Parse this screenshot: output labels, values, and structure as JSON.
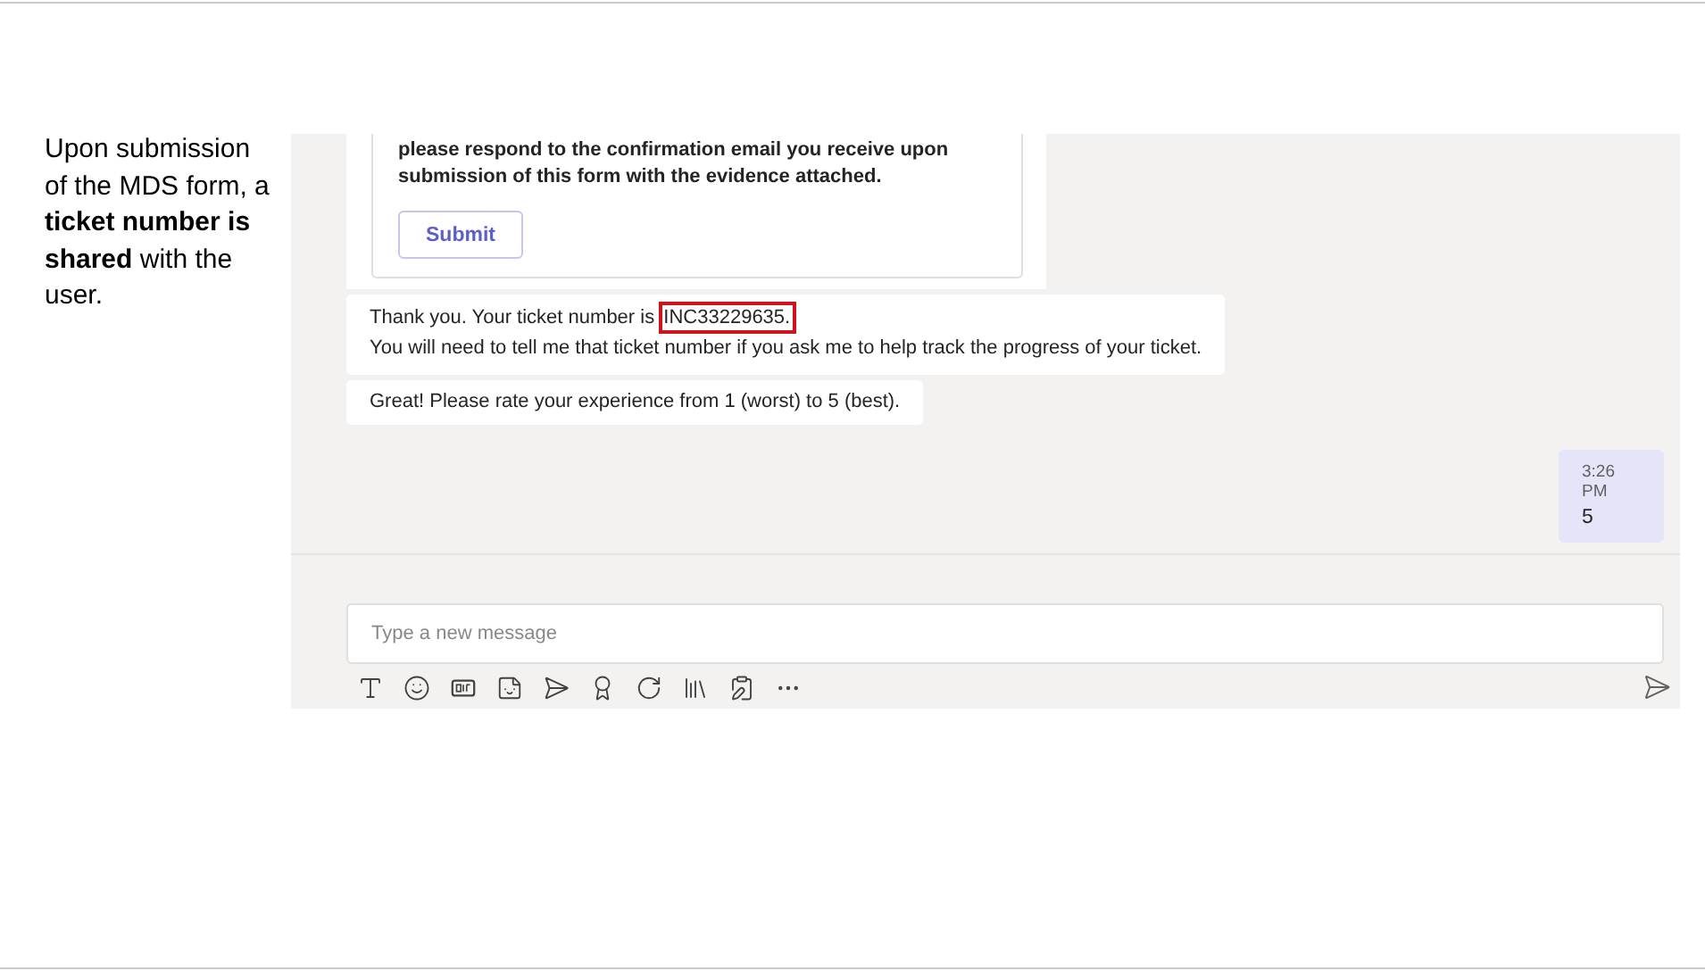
{
  "caption": "Upon submission of the MDS form, a **ticket number is shared** with the user.",
  "card": {
    "lines": [
      "please respond to the confirmation email you receive upon",
      "submission of this form with the evidence attached."
    ],
    "button": "Submit"
  },
  "messages": [
    {
      "kind": "ticket",
      "before": "Thank you. Your ticket number is ",
      "highlight": "INC33229635.",
      "line2": "You will need to tell me that ticket number if you ask me to help track the progress of your ticket."
    },
    {
      "kind": "plain",
      "text": "Great! Please rate your experience from 1 (worst) to 5 (best)."
    }
  ],
  "reply": {
    "time": "3:26 PM",
    "text": "5"
  },
  "compose": {
    "placeholder": "Type a new message"
  }
}
